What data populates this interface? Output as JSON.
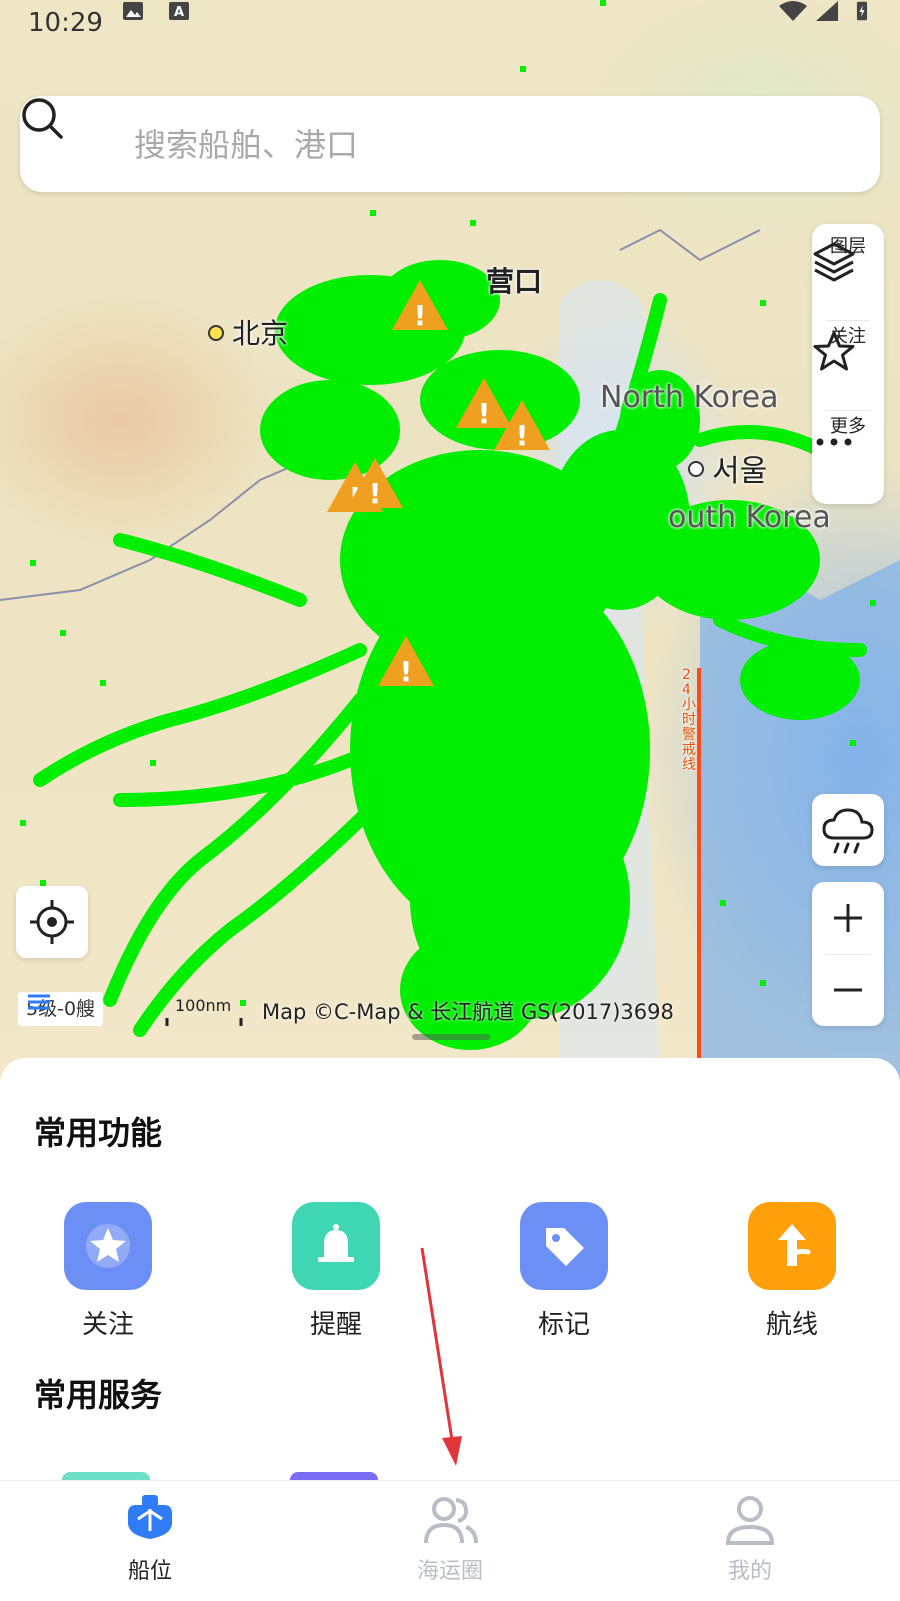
{
  "status_bar": {
    "time": "10:29"
  },
  "search": {
    "placeholder": "搜索船舶、港口"
  },
  "map": {
    "city_labels": [
      "北京",
      "营口",
      "서울"
    ],
    "country_labels": [
      "North Korea",
      "outh Korea"
    ],
    "warning_line_label": "24小时警戒线",
    "level_label": "5级-0艘",
    "scale_label": "100nm",
    "attribution": "Map ©C-Map & 长江航道 GS(2017)3698",
    "ship_color": "#00ee00",
    "warning_color": "#f0a020",
    "warning_line_color": "#ff4a1a"
  },
  "tools": {
    "layers_label": "图层",
    "follow_label": "关注",
    "more_label": "更多"
  },
  "sheet": {
    "common_functions_title": "常用功能",
    "functions": [
      {
        "label": "关注",
        "color": "#6c8ff5"
      },
      {
        "label": "提醒",
        "color": "#3fd6b4"
      },
      {
        "label": "标记",
        "color": "#6c8ff5"
      },
      {
        "label": "航线",
        "color": "#ff9f0a"
      }
    ],
    "common_services_title": "常用服务"
  },
  "nav": {
    "items": [
      {
        "label": "船位",
        "active": true
      },
      {
        "label": "海运圈",
        "active": false
      },
      {
        "label": "我的",
        "active": false
      }
    ],
    "active_color": "#2f7cf6",
    "inactive_color": "#b8bdc6"
  }
}
